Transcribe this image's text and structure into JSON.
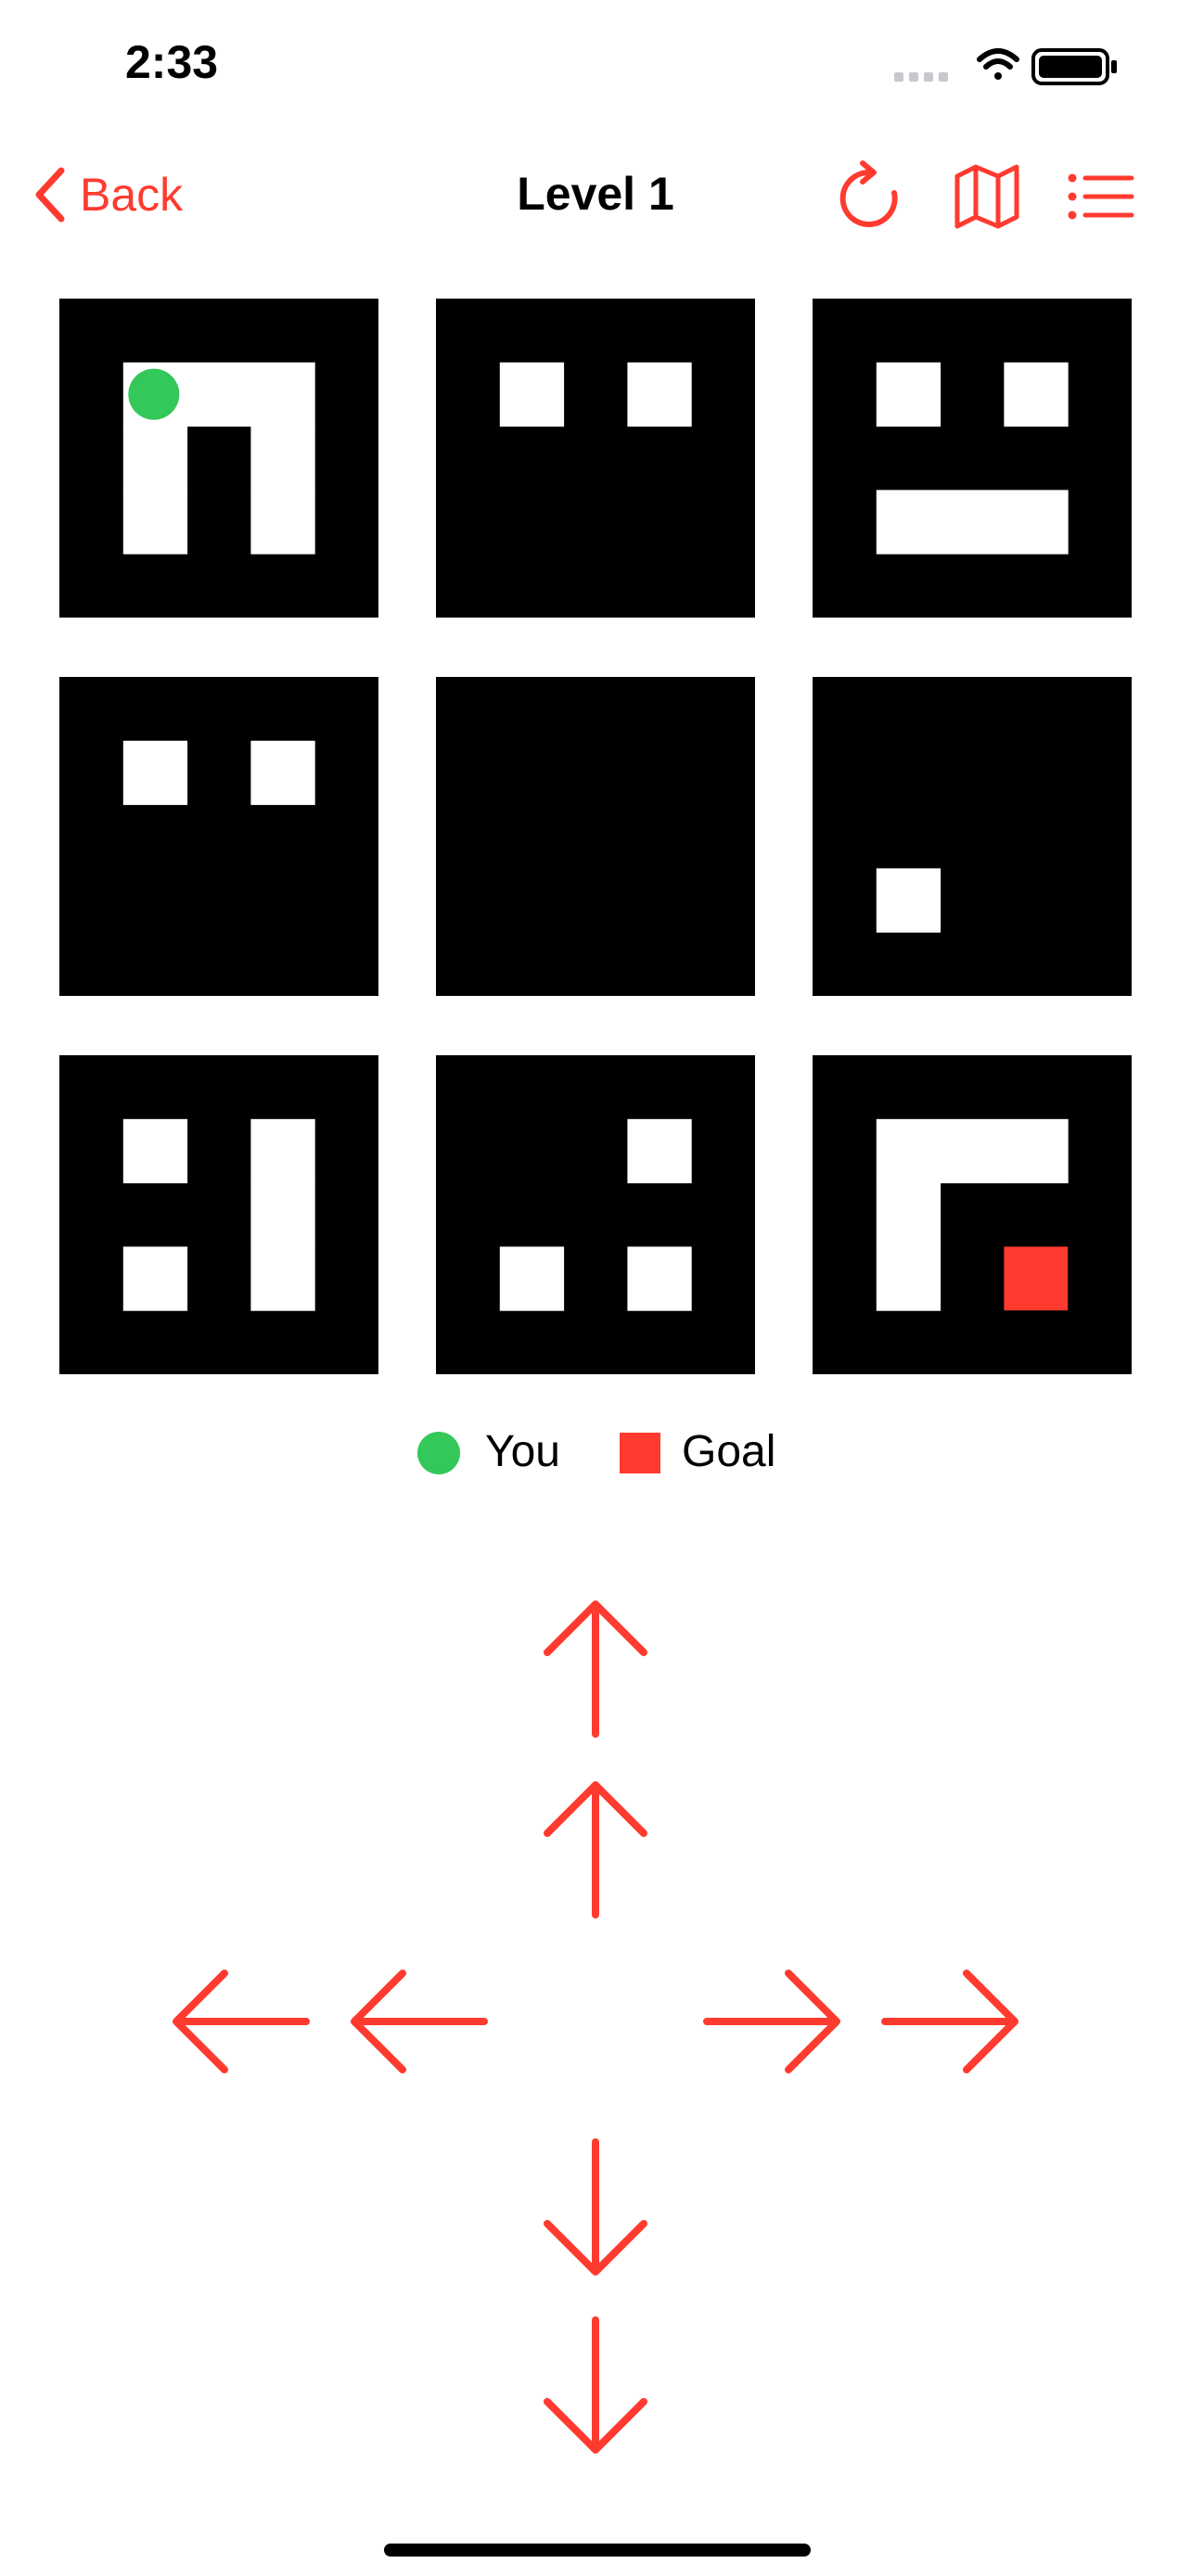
{
  "status_bar": {
    "time": "2:33"
  },
  "nav": {
    "back_label": "Back",
    "title": "Level 1",
    "icons": [
      "restart-icon",
      "map-icon",
      "list-icon"
    ]
  },
  "colors": {
    "accent": "#ff3b30",
    "player": "#34c759",
    "goal": "#ff3b30",
    "wall": "#000000",
    "floor": "#ffffff"
  },
  "board": {
    "rows": 3,
    "cols": 3,
    "room_grid_size": 5,
    "rooms": [
      {
        "open_cells": [
          [
            1,
            1
          ],
          [
            1,
            2
          ],
          [
            1,
            3
          ],
          [
            2,
            1
          ],
          [
            2,
            3
          ],
          [
            3,
            1
          ],
          [
            3,
            3
          ]
        ],
        "player": [
          1,
          1
        ]
      },
      {
        "open_cells": [
          [
            1,
            1
          ],
          [
            1,
            3
          ]
        ]
      },
      {
        "open_cells": [
          [
            1,
            1
          ],
          [
            1,
            3
          ],
          [
            3,
            1
          ],
          [
            3,
            2
          ],
          [
            3,
            3
          ]
        ]
      },
      {
        "open_cells": [
          [
            1,
            1
          ],
          [
            1,
            3
          ]
        ]
      },
      {
        "open_cells": []
      },
      {
        "open_cells": [
          [
            3,
            1
          ]
        ]
      },
      {
        "open_cells": [
          [
            1,
            1
          ],
          [
            1,
            3
          ],
          [
            2,
            3
          ],
          [
            3,
            1
          ],
          [
            3,
            3
          ]
        ]
      },
      {
        "open_cells": [
          [
            1,
            3
          ],
          [
            3,
            1
          ],
          [
            3,
            3
          ]
        ]
      },
      {
        "open_cells": [
          [
            1,
            1
          ],
          [
            1,
            2
          ],
          [
            1,
            3
          ],
          [
            2,
            1
          ],
          [
            3,
            1
          ]
        ],
        "goal": [
          3,
          3
        ]
      }
    ]
  },
  "legend": {
    "you_label": "You",
    "goal_label": "Goal"
  },
  "controls": {
    "buttons": [
      "up-far",
      "up",
      "left-far",
      "left",
      "right",
      "right-far",
      "down",
      "down-far"
    ]
  }
}
